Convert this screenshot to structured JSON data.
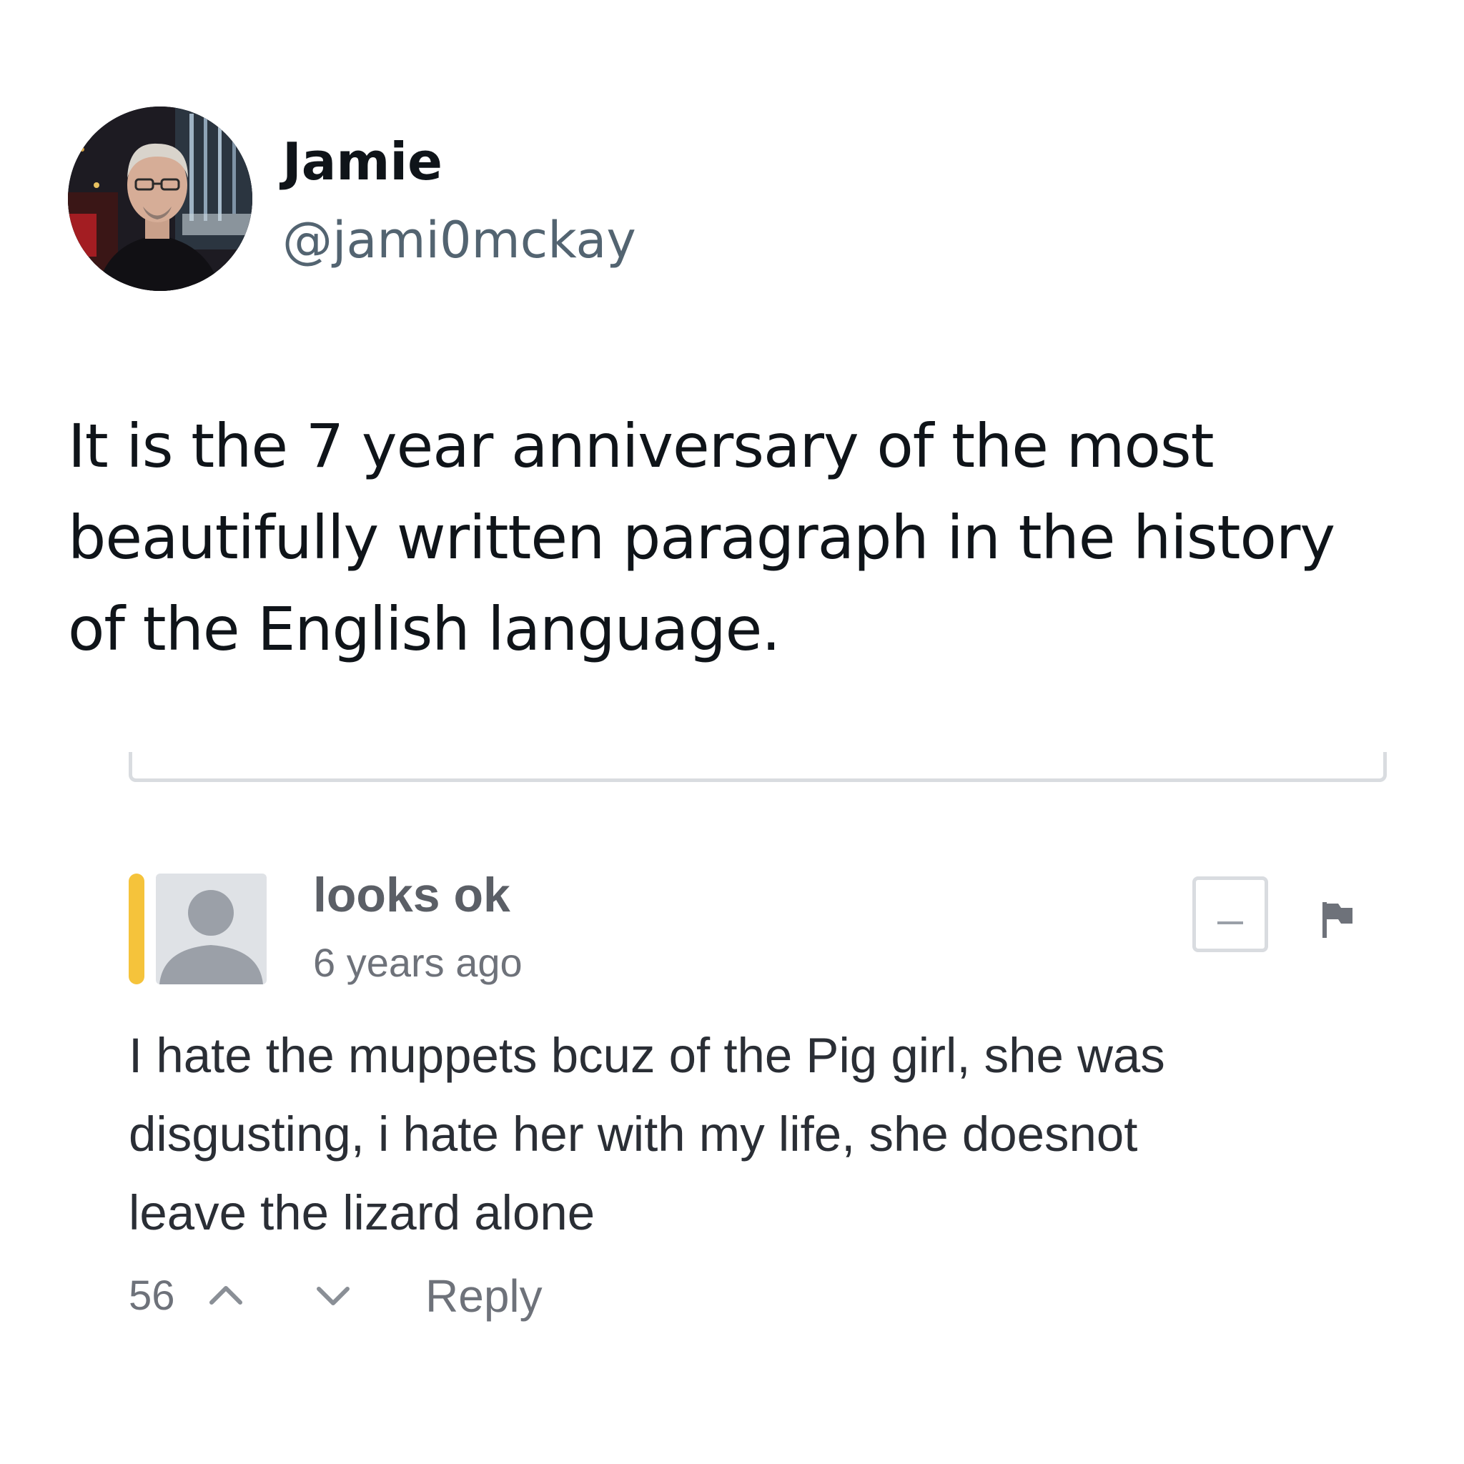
{
  "tweet": {
    "author": {
      "name": "Jamie",
      "handle": "@jami0mckay",
      "avatar_icon": "profile-photo-icon"
    },
    "text_lines": [
      "It is the 7 year anniversary of the most",
      "beautifully written paragraph in the history",
      "of the English language."
    ]
  },
  "embedded_comment": {
    "commenter": {
      "name": "looks ok",
      "time": "6 years ago",
      "avatar_icon": "default-user-icon",
      "accent_color": "#f5c33b"
    },
    "actions": {
      "collapse_icon": "minus-icon",
      "flag_icon": "flag-icon"
    },
    "body_lines": [
      "I hate the muppets bcuz of the Pig girl, she was",
      "disgusting, i hate her with my life, she doesnot",
      "leave the lizard alone"
    ],
    "footer": {
      "vote_count": "56",
      "upvote_icon": "chevron-up-icon",
      "downvote_icon": "chevron-down-icon",
      "reply_label": "Reply"
    }
  }
}
